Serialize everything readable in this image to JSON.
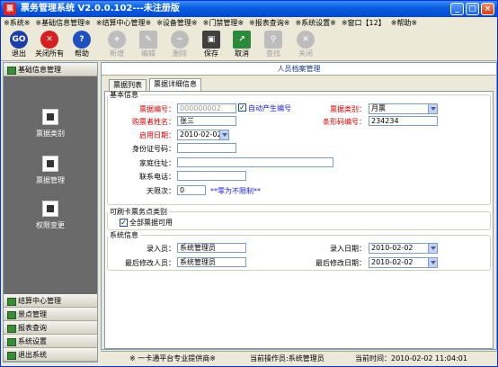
{
  "window": {
    "title": "票务管理系统 V2.0.0.102---未注册版",
    "app_icon": "app-icon",
    "minimize_icon": "minimize-icon",
    "maximize_icon": "maximize-icon",
    "close_icon": "close-icon",
    "title_color": "#0a5fe0"
  },
  "menu": [
    "※系统※",
    "※基础信息管理※",
    "※结算中心管理※",
    "※设备管理※",
    "※门禁管理※",
    "※报表查询※",
    "※系统设置※",
    "※窗口【12】",
    "※帮助※"
  ],
  "toolbar": [
    {
      "label": "退出",
      "icon": "go-icon",
      "enabled": true,
      "color": "#1f3fa8"
    },
    {
      "label": "关闭所有",
      "icon": "close-all-icon",
      "enabled": true,
      "color": "#d42020"
    },
    {
      "label": "帮助",
      "icon": "help-icon",
      "enabled": true,
      "color": "#2050c0"
    },
    {
      "label": "新增",
      "icon": "add-icon",
      "enabled": false
    },
    {
      "label": "编辑",
      "icon": "edit-icon",
      "enabled": false
    },
    {
      "label": "删除",
      "icon": "delete-icon",
      "enabled": false
    },
    {
      "label": "保存",
      "icon": "save-icon",
      "enabled": true,
      "color": "#404040"
    },
    {
      "label": "取消",
      "icon": "cancel-icon",
      "enabled": true,
      "color": "#2a8a3a"
    },
    {
      "label": "查找",
      "icon": "find-icon",
      "enabled": false
    },
    {
      "label": "关闭",
      "icon": "close-icon",
      "enabled": false
    }
  ],
  "sidebar": {
    "header": "基础信息管理",
    "items": [
      {
        "label": "票据类别",
        "icon": "ticket-type-icon"
      },
      {
        "label": "票据管理",
        "icon": "ticket-manage-icon"
      },
      {
        "label": "权限变更",
        "icon": "permission-icon"
      }
    ],
    "sections": [
      "结算中心管理",
      "景点管理",
      "报表查询",
      "系统设置",
      "退出系统"
    ]
  },
  "main": {
    "title": "人员档案管理",
    "tabs": [
      "票据列表",
      "票据详细信息"
    ],
    "basic_legend": "基本信息",
    "fields": {
      "ticket_no_label": "票据编号：",
      "ticket_no_value": "000000002",
      "auto_label": "自动产生编号",
      "auto_checked": "✓",
      "ticket_type_label": "票据类别：",
      "ticket_type_value": "月票",
      "buyer_label": "购票者姓名：",
      "buyer_value": "张三",
      "barcode_label": "条形码编号：",
      "barcode_value": "234234",
      "start_label": "启用日期：",
      "start_value": "2010-02-02",
      "id_label": "身份证号码：",
      "id_value": "",
      "address_label": "家庭住址：",
      "address_value": "",
      "phone_label": "联系电话：",
      "phone_value": "",
      "days_label": "天限次：",
      "days_value": "0",
      "days_note": "**零为不限制**"
    },
    "swipe_legend": "可刷卡票务点类别",
    "swipe_all_label": "全部票据可用",
    "swipe_all_checked": "✓",
    "sys_legend": "系统信息",
    "sys": {
      "entry_label": "录入员：",
      "entry_value": "系统管理员",
      "entry_date_label": "录入日期：",
      "entry_date_value": "2010-02-02",
      "mod_label": "最后修改人员：",
      "mod_value": "系统管理员",
      "mod_date_label": "最后修改日期：",
      "mod_date_value": "2010-02-02"
    }
  },
  "status": {
    "provider": "※ 一卡通平台专业提供商※",
    "operator": "当前操作员:系统管理员",
    "time": "当前时间：2010-02-02 11:04:01"
  },
  "colors": {
    "sidebar_panel": "#6a6a6a",
    "required_label": "#d00000",
    "note": "#2020d0"
  }
}
